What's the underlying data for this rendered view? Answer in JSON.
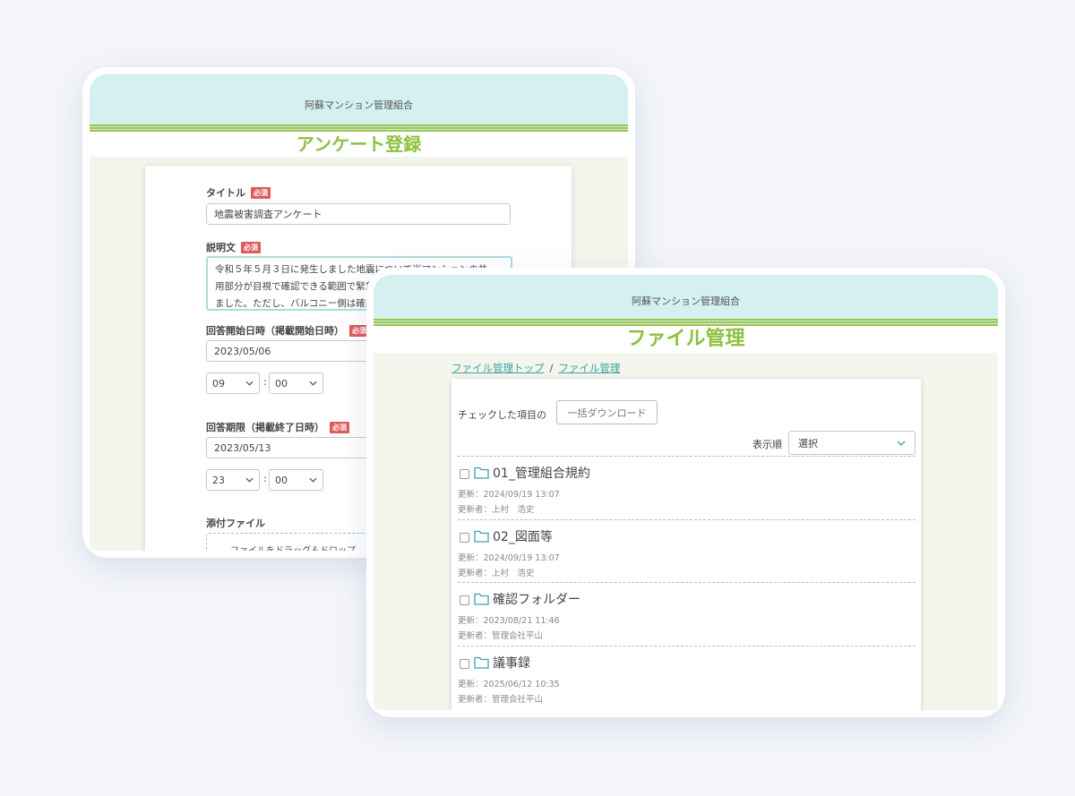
{
  "survey_screen": {
    "org_name": "阿蘇マンション管理組合",
    "page_title": "アンケート登録",
    "required_badge": "必須",
    "title_label": "タイトル",
    "title_value": "地震被害調査アンケート",
    "description_label": "説明文",
    "description_lines": [
      "令和５年５月３日に発生しました地震について当マンションの共",
      "用部分が目視で確認できる範囲で緊急",
      "ました。ただし、バルコニー側は確認"
    ],
    "start_label": "回答開始日時（掲載開始日時）",
    "start_date": "2023/05/06",
    "start_hour": "09",
    "start_minute": "00",
    "end_label": "回答期限（掲載終了日時）",
    "end_date": "2023/05/13",
    "end_hour": "23",
    "end_minute": "00",
    "time_separator": ":",
    "attachment_label": "添付ファイル",
    "dropzone_text": "ファイルをドラッグ＆ドロップ"
  },
  "files_screen": {
    "org_name": "阿蘇マンション管理組合",
    "page_title": "ファイル管理",
    "breadcrumb": [
      "ファイル管理トップ",
      "ファイル管理"
    ],
    "breadcrumb_separator": "/",
    "checked_label": "チェックした項目の",
    "bulk_download_button": "一括ダウンロード",
    "sort_label": "表示順",
    "sort_value": "選択",
    "folders": [
      {
        "name": "01_管理組合規約",
        "updated": "更新：2024/09/19 13:07",
        "updated_by": "更新者：上村　浩史"
      },
      {
        "name": "02_図面等",
        "updated": "更新：2024/09/19 13:07",
        "updated_by": "更新者：上村　浩史"
      },
      {
        "name": "確認フォルダー",
        "updated": "更新：2023/08/21 11:46",
        "updated_by": "更新者：管理会社平山"
      },
      {
        "name": "議事録",
        "updated": "更新：2025/06/12 10:35",
        "updated_by": "更新者：管理会社平山"
      }
    ]
  },
  "colors": {
    "accent_green": "#8cc13f",
    "header_teal": "#d4f0f0",
    "link_teal": "#3aa3a8",
    "required_red": "#e05a5a",
    "folder_teal": "#3aa3a8"
  },
  "icons": {
    "folder": "folder-icon",
    "dropdown": "chevron-down-icon",
    "checkbox": "checkbox-icon"
  }
}
